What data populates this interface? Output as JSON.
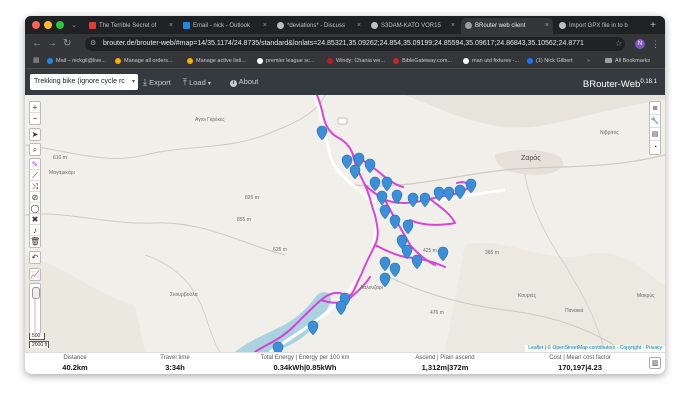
{
  "browser": {
    "tabs": [
      {
        "title": "The Terrible Secret of",
        "color": "#e53935"
      },
      {
        "title": "Email - nick - Outlook",
        "color": "#1e88e5"
      },
      {
        "title": "*deviations* - Discuss",
        "color": "#bdbdbd"
      },
      {
        "title": "S3DAM-KATO VOR15",
        "color": "#bdbdbd"
      },
      {
        "title": "BRouter web client",
        "color": "#9e9e9e"
      },
      {
        "title": "Import GPX file in to b",
        "color": "#bdbdbd"
      }
    ],
    "new_tab": "+",
    "url": "brouter.de/brouter-web/#map=14/35.1174/24.8735/standard&lonlats=24.85321,35.09262;24.854,35.09199;24.85594,35.09617;24.86843,35.10562;24.8771",
    "profile_initial": "N",
    "bookmarks": [
      "Mail – nickgil@live...",
      "Manage all orders...",
      "Manage active listi...",
      "premier league sc...",
      "Windy: Chania we...",
      "BibleGateway.com...",
      "man utd fixtures -...",
      "(1) Nick Gilbert"
    ],
    "all_bookmarks": "All Bookmarks"
  },
  "app": {
    "profile_select": "Trekking bike (ignore cycle rc",
    "export_label": "Export",
    "load_label": "Load",
    "about_label": "About",
    "brand": "BRouter-Web",
    "version": "0.18.1"
  },
  "map": {
    "labels": {
      "town": "Ζαρός",
      "place_w": "Μαγαρικάρι",
      "place_sw": "Σκουρβούλα",
      "place_se": "Κουρτές",
      "place_mid": "Λαλουζάρι",
      "place_ne": "Νιβρίτος",
      "place_e": "Μακρύς",
      "place_far_e": "Πανακιά",
      "place_plateau": "Αγιοι Γκρέκες",
      "elev_1": "610 m",
      "elev_2": "855 m",
      "elev_3": "826 m",
      "elev_4": "425 m",
      "elev_5": "365 m",
      "elev_6": "476 m",
      "elev_7": "625 m"
    },
    "scale_m": "500 m",
    "scale_ft": "2000 ft",
    "attribution_leaflet": "Leaflet",
    "attribution_osm": "© OpenStreetMap contributors",
    "attribution_copyright": "Copyright",
    "attribution_privacy": "Privacy",
    "colors": {
      "route": "#d633d6",
      "marker": "#3b8fd8",
      "water": "#aad3df"
    }
  },
  "stats": {
    "distance": {
      "title": "Distance",
      "value": "40.2km"
    },
    "travel_time": {
      "title": "Travel time",
      "value": "3:34h"
    },
    "energy": {
      "title": "Total Energy | Energy per 100 km",
      "value": "0.34kWh|0.85kWh"
    },
    "ascend": {
      "title": "Ascend | Plain ascend",
      "value": "1,312m|372m"
    },
    "cost": {
      "title": "Cost | Mean cost factor",
      "value": "170,197|4.23"
    }
  }
}
